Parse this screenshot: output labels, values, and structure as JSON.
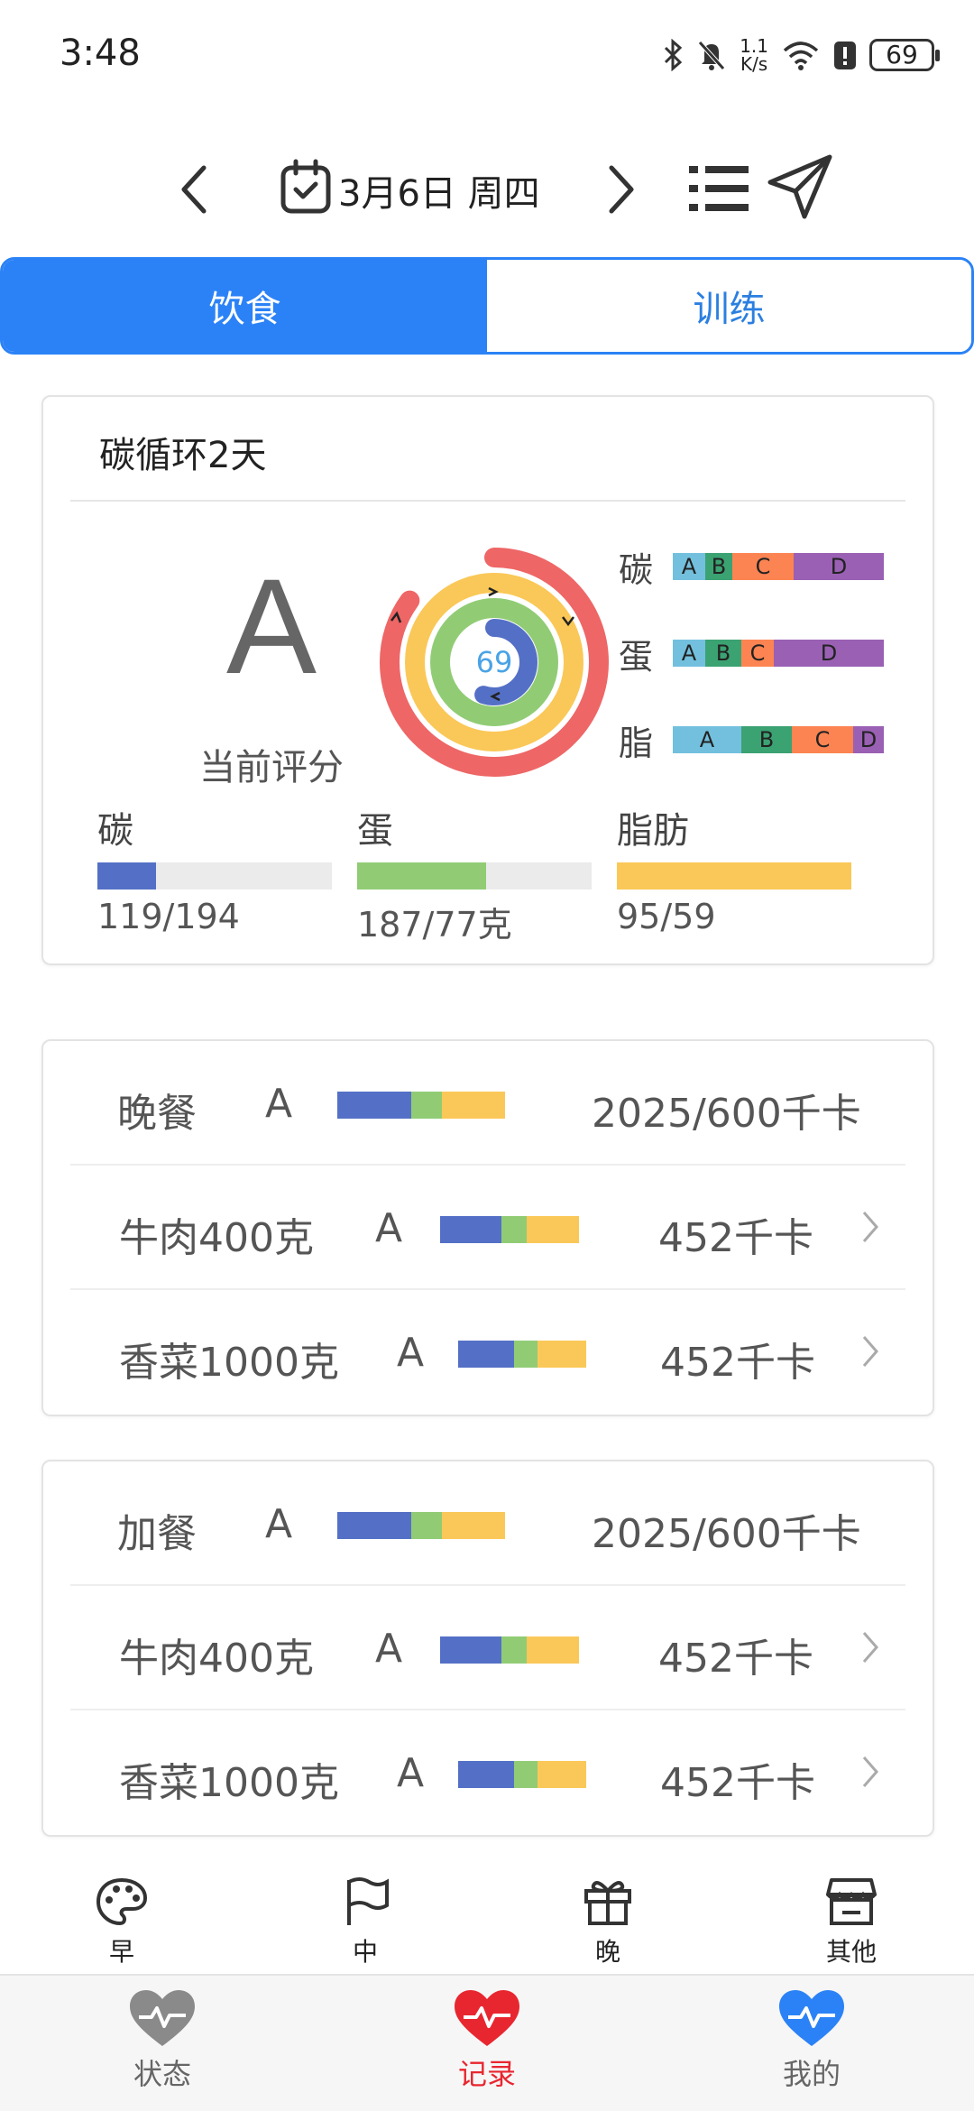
{
  "status_bar": {
    "time": "3:48",
    "net_speed_value": "1.1",
    "net_speed_unit": "K/s",
    "battery": "69",
    "icons": [
      "bluetooth-icon",
      "bell-off-icon",
      "wifi-icon",
      "alert-icon",
      "battery-icon"
    ]
  },
  "date_nav": {
    "date": "3月6日 周四",
    "icons": [
      "chevron-left-icon",
      "calendar-check-icon",
      "chevron-right-icon",
      "list-icon",
      "send-icon"
    ]
  },
  "tabs": [
    {
      "label": "饮食",
      "active": true
    },
    {
      "label": "训练",
      "active": false
    }
  ],
  "summary": {
    "title": "碳循环2天",
    "grade": "A",
    "grade_caption": "当前评分",
    "ring_value": "69",
    "ring_levels": {
      "outer": 0.85,
      "middle": 0.8,
      "inner": 0.55
    },
    "scales": [
      {
        "label": "碳",
        "segments": [
          "A",
          "B",
          "C",
          "D"
        ]
      },
      {
        "label": "蛋",
        "segments": [
          "A",
          "B",
          "C",
          "D"
        ]
      },
      {
        "label": "脂",
        "segments": [
          "A",
          "B",
          "C",
          "D"
        ]
      }
    ],
    "macros": [
      {
        "name": "碳",
        "value": "119/194",
        "fraction": 0.25,
        "color": "#5470c6"
      },
      {
        "name": "蛋",
        "value": "187/77克",
        "fraction": 0.55,
        "color": "#91cc75"
      },
      {
        "name": "脂肪",
        "value": "95/59",
        "fraction": 1.0,
        "color": "#fac858"
      }
    ]
  },
  "meals": [
    {
      "name": "晚餐",
      "grade": "A",
      "kcal": "2025/600千卡",
      "items": [
        {
          "name": "牛肉400克",
          "grade": "A",
          "kcal": "452千卡"
        },
        {
          "name": "香菜1000克",
          "grade": "A",
          "kcal": "452千卡"
        }
      ]
    },
    {
      "name": "加餐",
      "grade": "A",
      "kcal": "2025/600千卡",
      "items": [
        {
          "name": "牛肉400克",
          "grade": "A",
          "kcal": "452千卡"
        },
        {
          "name": "香菜1000克",
          "grade": "A",
          "kcal": "452千卡"
        }
      ]
    }
  ],
  "time_of_day": [
    {
      "label": "早",
      "icon": "palette-icon"
    },
    {
      "label": "中",
      "icon": "flag-icon"
    },
    {
      "label": "晚",
      "icon": "gift-icon"
    },
    {
      "label": "其他",
      "icon": "store-icon"
    }
  ],
  "bottom_nav": [
    {
      "label": "状态",
      "icon": "heart-pulse-icon",
      "color": "#8a8a8a"
    },
    {
      "label": "记录",
      "icon": "heart-pulse-icon",
      "color": "#e8262f"
    },
    {
      "label": "我的",
      "icon": "heart-pulse-icon",
      "color": "#2b82f6"
    }
  ],
  "colors": {
    "accent": "#2b82f6",
    "carb": "#5470c6",
    "protein": "#91cc75",
    "fat": "#fac858",
    "ring_outer": "#ee6666",
    "scale_a": "#73c0de",
    "scale_b": "#3ba272",
    "scale_c": "#fc8452",
    "scale_d": "#9a60b4"
  }
}
